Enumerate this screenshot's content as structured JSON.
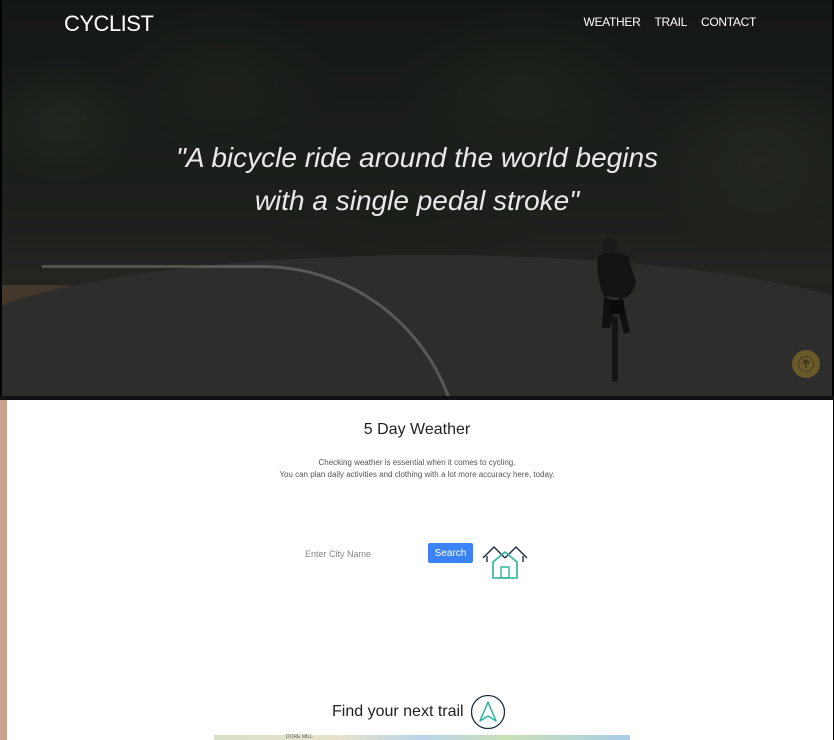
{
  "header": {
    "brand": "CYCLIST",
    "nav": [
      "WEATHER",
      "TRAIL",
      "CONTACT"
    ]
  },
  "hero": {
    "quote_line1": "\"A bicycle ride around the world begins",
    "quote_line2": "with a single pedal stroke\""
  },
  "weather": {
    "title": "5 Day Weather",
    "desc_line1": "Checking weather is essential when it comes to cycling.",
    "desc_line2": "You can plan daily activities and clothing with a lot more accuracy here, today.",
    "input_placeholder": "Enter City Name",
    "search_label": "Search"
  },
  "trail": {
    "title": "Find your next trail",
    "map_label": "DORE MILL"
  },
  "colors": {
    "accent": "#3b82f6",
    "home_icon": "#2bb39b",
    "scroll_button": "#6a5a2b"
  },
  "icons": [
    "scroll-up-icon",
    "home-icon",
    "navigation-arrow-icon"
  ]
}
